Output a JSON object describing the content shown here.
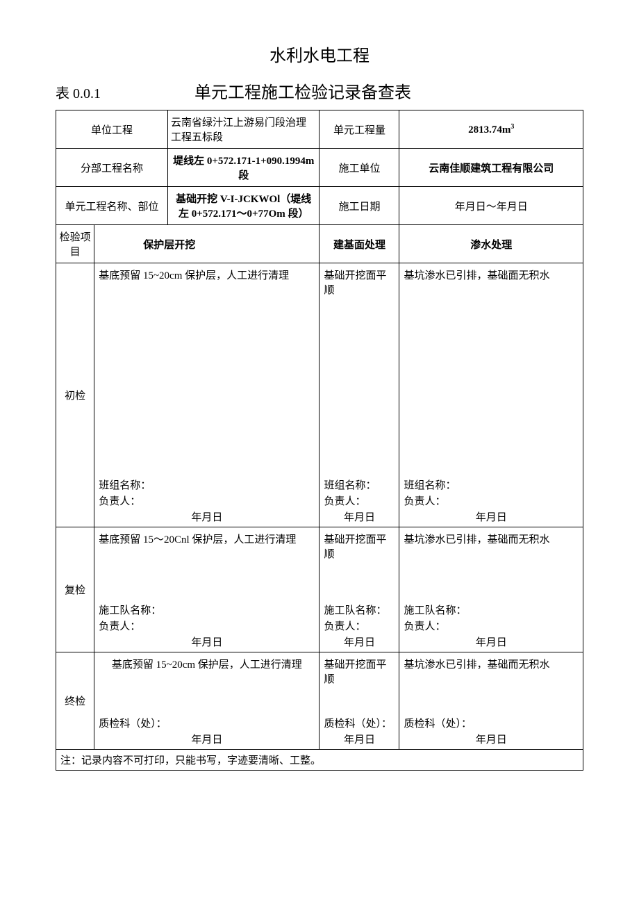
{
  "header": {
    "title1": "水利水电工程",
    "table_no": "表 0.0.1",
    "title2": "单元工程施工检验记录备查表"
  },
  "labels": {
    "unit_project": "单位工程",
    "unit_qty": "单元工程量",
    "subdiv_name": "分部工程名称",
    "constr_unit": "施工单位",
    "unit_name_pos": "单元工程名称、部位",
    "constr_date": "施工日期",
    "insp_item": "检验项目",
    "col1": "保护层开挖",
    "col2": "建基面处理",
    "col3": "渗水处理",
    "initial": "初检",
    "recheck": "复检",
    "final": "终检",
    "team_name": "班组名称：",
    "crew_name": "施工队名称：",
    "qc_dept": "质检科（处）：",
    "person": "负责人：",
    "date": "年月日",
    "note": "注：记录内容不可打印，只能书写，字迹要清晰、工整。"
  },
  "values": {
    "unit_project": "云南省绿汁江上游易门段治理工程五标段",
    "unit_qty_html": "2813.74m",
    "unit_qty_sup": "3",
    "subdiv_name": "堤线左 0+572.171-1+090.1994m 段",
    "constr_unit": "云南佳顺建筑工程有限公司",
    "unit_name_pos": "基础开挖 V-I-JCKWOl（堤线左 0+572.171～0+77Om 段）",
    "constr_date": "年月日～年月日"
  },
  "content": {
    "init_c1": "基底预留 15~20cm 保护层，人工进行清理",
    "init_c2": "基础开挖面平顺",
    "init_c3": "基坑渗水已引排，基础面无积水",
    "re_c1": "基底预留 15～20Cnl 保护层，人工进行清理",
    "re_c2": "基础开挖面平顺",
    "re_c3": "基坑渗水已引排，基础而无积水",
    "fin_c1": "基底预留 15~20cm 保护层，人工进行清理",
    "fin_c2": "基础开挖面平顺",
    "fin_c3": "基坑渗水已引排，基础而无积水"
  }
}
